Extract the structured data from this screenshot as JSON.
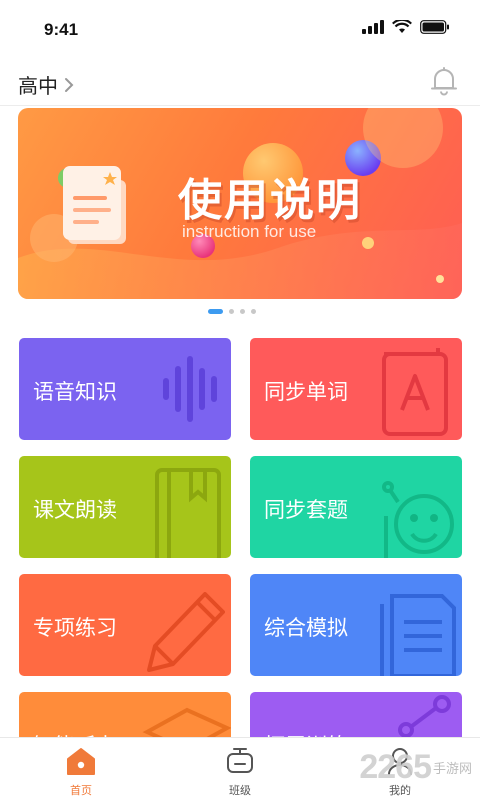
{
  "status_bar": {
    "time": "9:41"
  },
  "header": {
    "grade": "高中"
  },
  "banner": {
    "title": "使用说明",
    "subtitle": "instruction for use"
  },
  "carousel": {
    "count": 4,
    "active_index": 0
  },
  "features": [
    {
      "label": "语音知识",
      "color": "#7b63f0",
      "icon": "sound-wave-icon"
    },
    {
      "label": "同步单词",
      "color": "#ff5a5a",
      "icon": "letter-a-book-icon"
    },
    {
      "label": "课文朗读",
      "color": "#a6c51a",
      "icon": "book-icon"
    },
    {
      "label": "同步套题",
      "color": "#1fd5a3",
      "icon": "smiley-robot-icon"
    },
    {
      "label": "专项练习",
      "color": "#ff6a42",
      "icon": "pencil-icon"
    },
    {
      "label": "综合模拟",
      "color": "#4f86f7",
      "icon": "document-icon"
    },
    {
      "label": "智能听力",
      "color": "#ff8c3a",
      "icon": "stack-icon"
    },
    {
      "label": "拓展训练",
      "color": "#9d5cf2",
      "icon": "molecule-icon"
    }
  ],
  "tabbar": {
    "items": [
      {
        "label": "首页",
        "icon": "home-icon",
        "active": true
      },
      {
        "label": "班级",
        "icon": "tv-icon",
        "active": false
      },
      {
        "label": "我的",
        "icon": "person-icon",
        "active": false
      }
    ],
    "active_color": "#f07a3a"
  },
  "watermark": {
    "big": "2265",
    "small": "手游网"
  }
}
